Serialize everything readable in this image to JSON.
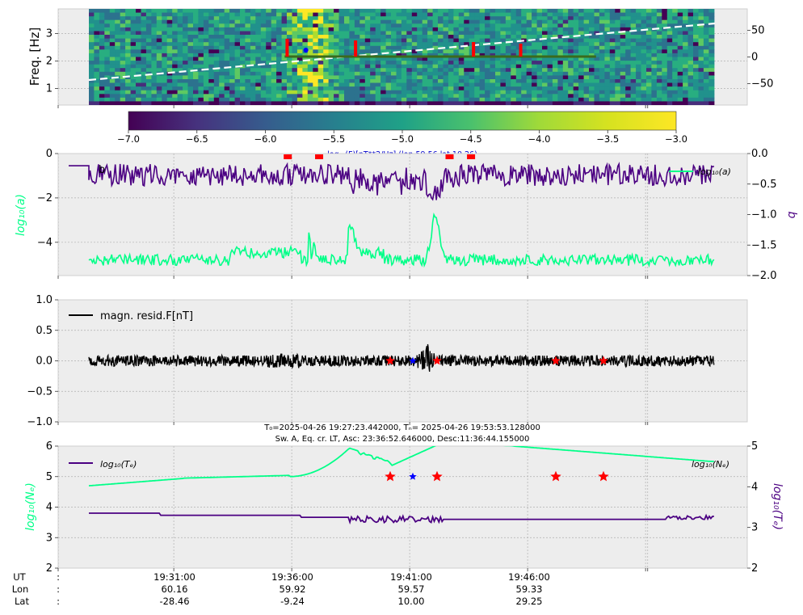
{
  "chart_data": [
    {
      "type": "heatmap",
      "panel": "spectrogram",
      "ylabel": "Freq. [Hz]",
      "y_ticks": [
        "1",
        "2",
        "3"
      ],
      "ylim": [
        0.4,
        3.9
      ],
      "right_ticks": [
        "50",
        "0",
        "−50"
      ],
      "right_ylim": [
        -90,
        90
      ],
      "colorbar_ticks": [
        "−7.0",
        "−6.5",
        "−6.0",
        "−5.5",
        "−5.0",
        "−4.5",
        "−4.0",
        "−3.5",
        "−3.0"
      ],
      "colorbar_range": [
        -7.0,
        -3.0
      ],
      "colorbar_label": "log₁₀(F)[nT**2/Hz] (lon 59.56 lat 10.26)",
      "colors": {
        "dashed_line": "#ffffff",
        "track_line": "#3a6b1c",
        "marker_red": "#ff0000",
        "marker_blue": "#0000ff"
      }
    },
    {
      "type": "line",
      "panel": "log_a_b",
      "panel_letter": "b",
      "ylabel_left": "log₁₀(a)",
      "ylabel_right": "b",
      "legend": "log₁₀(a)",
      "left_ticks": [
        "0",
        "−2",
        "−4"
      ],
      "left_ylim": [
        -5.5,
        0
      ],
      "right_ticks": [
        "0.0",
        "−0.5",
        "−1.0",
        "−1.5",
        "−2.0"
      ],
      "right_ylim": [
        -2.0,
        0.0
      ],
      "colors": {
        "a": "#00ff88",
        "b": "#4b0082"
      }
    },
    {
      "type": "line",
      "panel": "magnetic_residual",
      "legend": "magn. resid.F[nT]",
      "y_ticks": [
        "1.0",
        "0.5",
        "0.0",
        "−0.5",
        "−1.0"
      ],
      "ylim": [
        -1.0,
        1.0
      ],
      "colors": {
        "series": "#000000"
      }
    },
    {
      "type": "line",
      "panel": "plasma",
      "title_line1": "T₀=2025-04-26 19:27:23.442000, Tₙ= 2025-04-26 19:53:53.128000",
      "title_line2": "Sw. A, Eq. cr. LT, Asc: 23:36:52.646000, Desc:11:36:44.155000",
      "ylabel_left": "log₁₀(Nₑ)",
      "ylabel_right": "log₁₀(Tₑ)",
      "legend_left": "log₁₀(Tₑ)",
      "legend_right": "log₁₀(Nₑ)",
      "left_ticks": [
        "6",
        "5",
        "4",
        "3",
        "2"
      ],
      "left_ylim": [
        2,
        6
      ],
      "right_ticks": [
        "5",
        "4",
        "3",
        "2"
      ],
      "right_ylim": [
        2,
        5
      ],
      "colors": {
        "Ne": "#00ff88",
        "Te": "#4b0082"
      }
    }
  ],
  "axis_info": {
    "row_labels": [
      "UT",
      "Lon",
      "Lat"
    ],
    "separator": ":",
    "ut": [
      "19:31:00",
      "19:36:00",
      "19:41:00",
      "19:46:00"
    ],
    "lon": [
      "60.16",
      "59.92",
      "59.57",
      "59.33"
    ],
    "lat": [
      "-28.46",
      "-9.24",
      "10.00",
      "29.25"
    ]
  },
  "events": {
    "red_times_min": [
      8.2,
      11.1,
      16.1,
      18.1
    ],
    "blue_time_min": 9.2
  }
}
